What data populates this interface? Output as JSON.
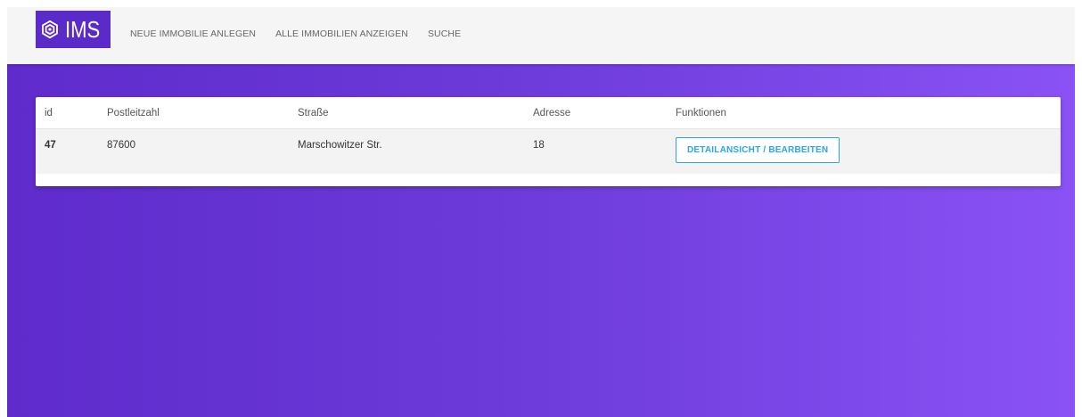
{
  "navbar": {
    "brand": "IMS",
    "links": [
      "NEUE IMMOBILIE ANLEGEN",
      "ALLE IMMOBILIEN ANZEIGEN",
      "SUCHE"
    ]
  },
  "table": {
    "headers": [
      "id",
      "Postleitzahl",
      "Straße",
      "Adresse",
      "Funktionen"
    ],
    "rows": [
      {
        "id": "47",
        "postleitzahl": "87600",
        "strasse": "Marschowitzer Str.",
        "adresse": "18",
        "action": "DETAILANSICHT / BEARBEITEN"
      }
    ]
  },
  "colors": {
    "brand_bg": "#5b2bc9",
    "gradient_start": "#5f2bcc",
    "gradient_end": "#8a52f5",
    "button_accent": "#29a6e8"
  },
  "icons": {
    "brand": "hexagon-logo-icon"
  }
}
